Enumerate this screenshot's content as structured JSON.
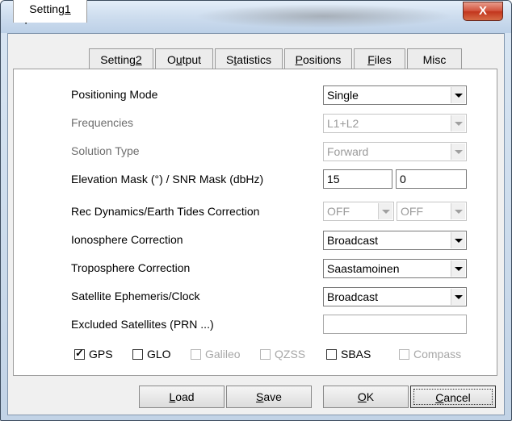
{
  "window": {
    "title": "Options",
    "close_label": "X"
  },
  "tabs": [
    {
      "pre": "Setting",
      "u": "1",
      "post": ""
    },
    {
      "pre": "Setting",
      "u": "2",
      "post": ""
    },
    {
      "pre": "O",
      "u": "u",
      "post": "tput"
    },
    {
      "pre": "S",
      "u": "t",
      "post": "atistics"
    },
    {
      "pre": "",
      "u": "P",
      "post": "ositions"
    },
    {
      "pre": "",
      "u": "F",
      "post": "iles"
    },
    {
      "pre": "Misc",
      "u": "",
      "post": ""
    }
  ],
  "settings": {
    "positioning_mode": {
      "label": "Positioning Mode",
      "value": "Single"
    },
    "frequencies": {
      "label": "Frequencies",
      "value": "L1+L2"
    },
    "solution_type": {
      "label": "Solution Type",
      "value": "Forward"
    },
    "elevation_mask": {
      "label": "Elevation Mask (°) / SNR Mask (dbHz)",
      "elev_value": "15",
      "snr_value": "0"
    },
    "rec_dynamics": {
      "label": "Rec Dynamics/Earth Tides Correction",
      "dyn_value": "OFF",
      "tide_value": "OFF"
    },
    "ionosphere": {
      "label": "Ionosphere Correction",
      "value": "Broadcast"
    },
    "troposphere": {
      "label": "Troposphere Correction",
      "value": "Saastamoinen"
    },
    "ephemeris": {
      "label": "Satellite Ephemeris/Clock",
      "value": "Broadcast"
    },
    "excluded": {
      "label": "Excluded Satellites (PRN ...)",
      "value": ""
    }
  },
  "systems": [
    {
      "label": "GPS",
      "checked": true,
      "enabled": true
    },
    {
      "label": "GLO",
      "checked": false,
      "enabled": true
    },
    {
      "label": "Galileo",
      "checked": false,
      "enabled": false
    },
    {
      "label": "QZSS",
      "checked": false,
      "enabled": false
    },
    {
      "label": "SBAS",
      "checked": false,
      "enabled": true
    },
    {
      "label": "Compass",
      "checked": false,
      "enabled": false
    }
  ],
  "buttons": {
    "load": {
      "u": "L",
      "post": "oad"
    },
    "save": {
      "u": "S",
      "post": "ave"
    },
    "ok": {
      "u": "O",
      "post": "K"
    },
    "cancel": {
      "u": "C",
      "post": "ancel"
    }
  }
}
